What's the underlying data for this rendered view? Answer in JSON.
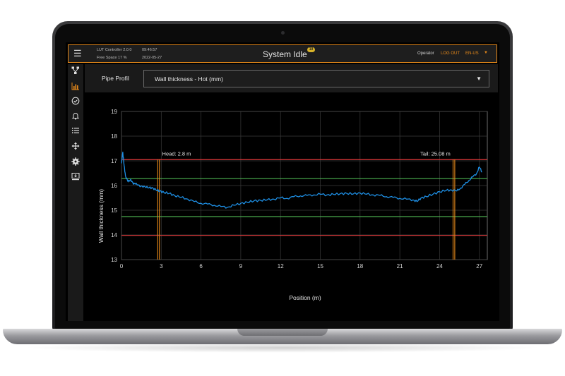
{
  "header": {
    "app_version": "LUT Controller 2.0.0",
    "free_space": "Free Space 17 %",
    "time": "09:46:57",
    "date": "2022-05-27",
    "title": "System Idle",
    "notification_count": "19",
    "role": "Operator",
    "logout_label": "LOG OUT",
    "language": "EN-US",
    "accent_color": "#e88a1a"
  },
  "sidebar": {
    "items": [
      {
        "icon": "network-icon"
      },
      {
        "icon": "bar-chart-icon",
        "active": true
      },
      {
        "icon": "check-circle-icon"
      },
      {
        "icon": "bell-icon"
      },
      {
        "icon": "list-icon"
      },
      {
        "icon": "move-arrows-icon"
      },
      {
        "icon": "gear-icon"
      },
      {
        "icon": "monitor-download-icon"
      }
    ]
  },
  "selector": {
    "label": "Pipe Profil",
    "value": "Wall thickness - Hot (mm)"
  },
  "chart_data": {
    "type": "line",
    "xlabel": "Position (m)",
    "ylabel": "Wall thickness (mm)",
    "xlim": [
      0,
      27.6
    ],
    "ylim": [
      13,
      19
    ],
    "xticks": [
      0,
      3,
      6,
      9,
      12,
      15,
      18,
      21,
      24,
      27
    ],
    "yticks": [
      13,
      14,
      15,
      16,
      17,
      18,
      19
    ],
    "grid": true,
    "series_color": "#1e90e6",
    "series": [
      {
        "x": [
          0,
          0.1,
          0.2,
          0.3,
          0.5,
          0.7,
          0.9,
          1.1,
          1.4,
          1.7,
          2.0,
          2.3,
          2.6,
          2.9,
          3.2,
          3.6,
          4.0,
          4.5,
          5.0,
          5.5,
          6.0,
          6.5,
          7.0,
          7.5,
          8.0,
          8.5,
          9.0,
          9.5,
          10.0,
          10.5,
          11.0,
          11.5,
          12.0,
          12.5,
          13.0,
          13.5,
          14.0,
          14.5,
          15.0,
          15.5,
          16.0,
          16.5,
          17.0,
          17.5,
          18.0,
          18.5,
          19.0,
          19.5,
          20.0,
          20.5,
          21.0,
          21.5,
          22.0,
          22.3,
          22.6,
          23.0,
          23.5,
          24.0,
          24.5,
          24.9,
          25.3,
          25.6,
          25.9,
          26.2,
          26.5,
          26.8,
          27.0,
          27.2
        ],
        "y": [
          16.9,
          17.35,
          16.8,
          16.4,
          16.15,
          16.25,
          16.05,
          16.1,
          15.95,
          15.98,
          15.9,
          15.92,
          15.82,
          15.78,
          15.72,
          15.68,
          15.6,
          15.52,
          15.45,
          15.35,
          15.28,
          15.25,
          15.2,
          15.15,
          15.12,
          15.2,
          15.28,
          15.32,
          15.38,
          15.4,
          15.42,
          15.45,
          15.5,
          15.48,
          15.55,
          15.58,
          15.6,
          15.62,
          15.65,
          15.62,
          15.64,
          15.67,
          15.68,
          15.66,
          15.7,
          15.65,
          15.62,
          15.6,
          15.55,
          15.52,
          15.48,
          15.45,
          15.42,
          15.35,
          15.5,
          15.55,
          15.65,
          15.75,
          15.8,
          15.82,
          15.78,
          15.9,
          16.05,
          16.2,
          16.35,
          16.5,
          16.75,
          16.55
        ]
      }
    ],
    "limits": {
      "upper_red": 17.05,
      "lower_red": 13.98,
      "upper_green": 16.28,
      "lower_green": 14.74,
      "red_color": "#e0383a",
      "green_color": "#4caf50"
    },
    "markers": [
      {
        "label": "Head: 2.8 m",
        "x": 2.8,
        "color": "#e88a1a"
      },
      {
        "label": "Tail: 25.08 m",
        "x": 25.08,
        "color": "#e88a1a"
      }
    ]
  }
}
